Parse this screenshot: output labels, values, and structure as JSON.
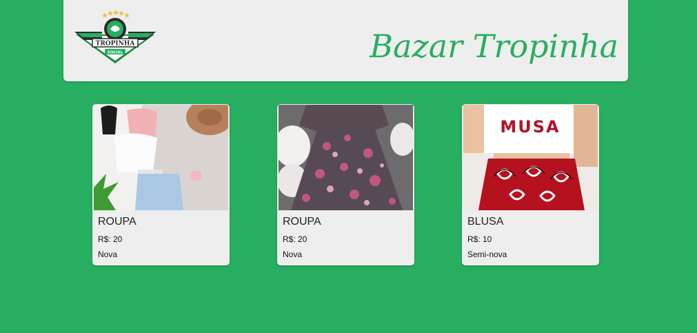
{
  "header": {
    "title": "Bazar Tropinha",
    "logo": {
      "name": "TROPINHA",
      "sub": "SOCIAL"
    }
  },
  "colors": {
    "brand": "#27ae60",
    "panel": "#eeeeee"
  },
  "products": [
    {
      "name": "ROUPA",
      "price": "R$: 20",
      "condition": "Nova",
      "image": "outfit-flatlay-photo"
    },
    {
      "name": "ROUPA",
      "price": "R$: 20",
      "condition": "Nova",
      "image": "floral-dress-photo"
    },
    {
      "name": "BLUSA",
      "price": "R$: 10",
      "condition": "Semi-nova",
      "image": "musa-top-shorts-photo"
    }
  ]
}
